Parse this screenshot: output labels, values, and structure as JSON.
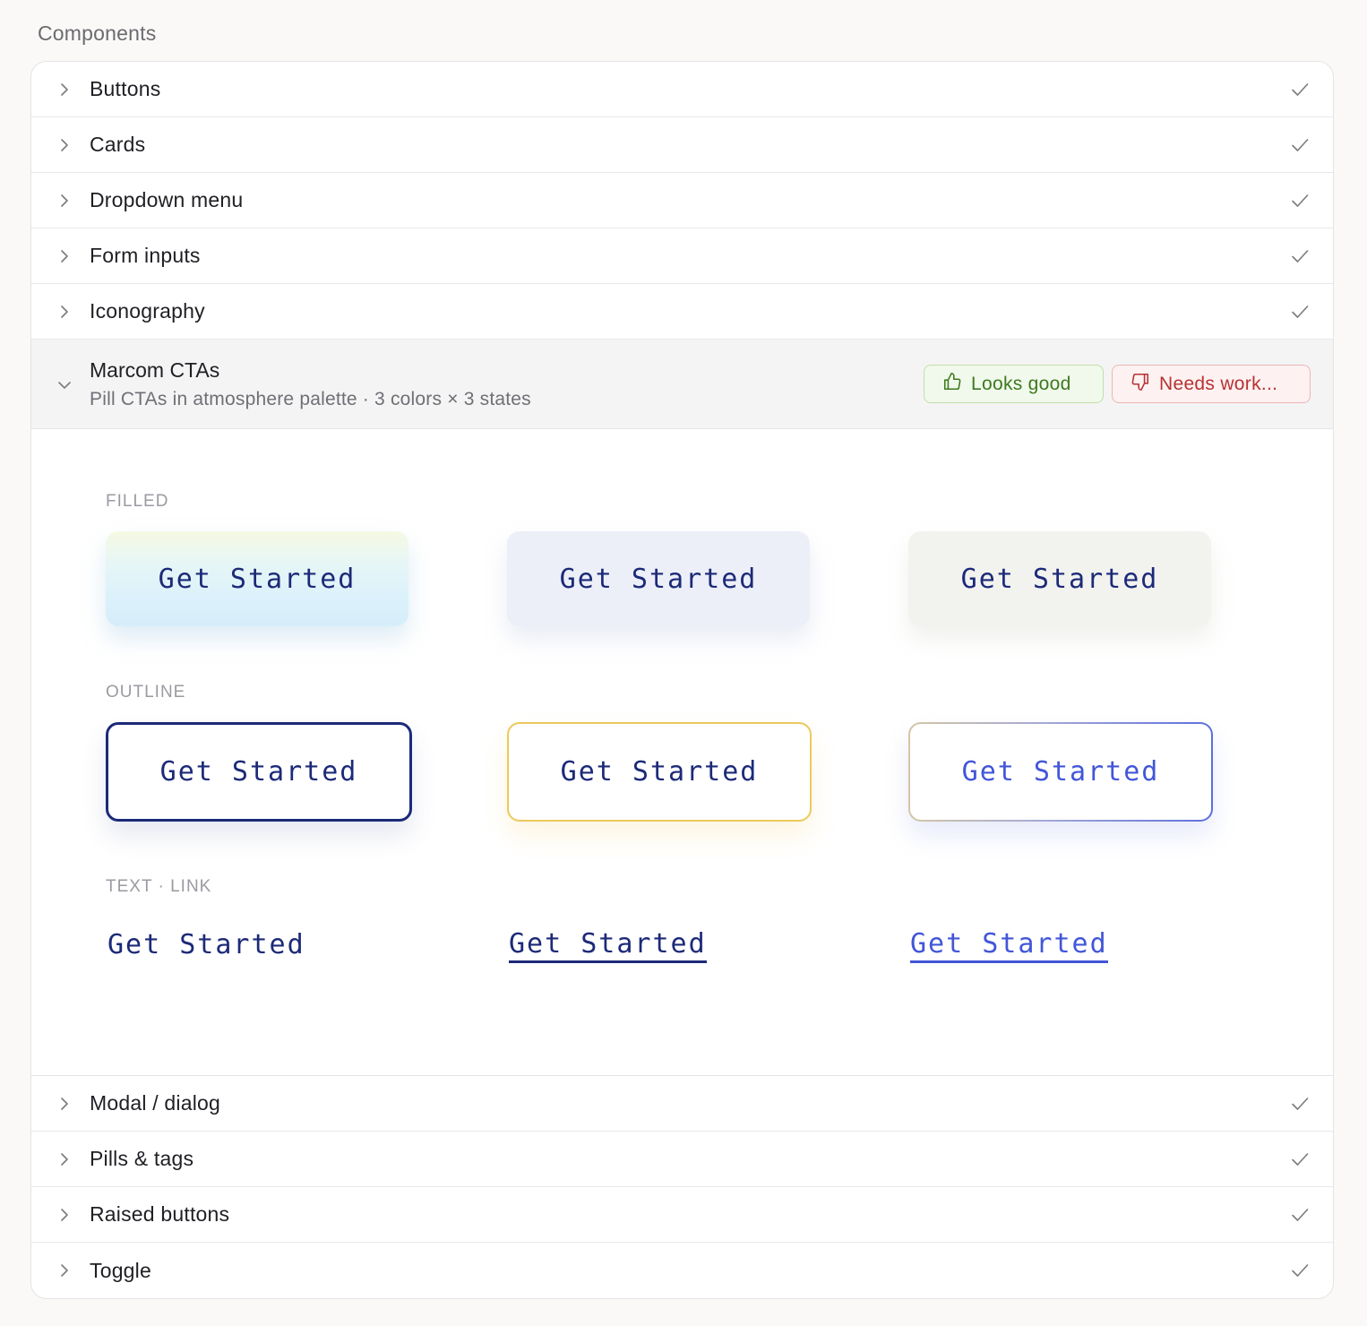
{
  "section": {
    "title": "Components"
  },
  "accordion": {
    "items_top": [
      {
        "label": "Buttons",
        "status_icon": "check-icon"
      },
      {
        "label": "Cards",
        "status_icon": "check-icon"
      },
      {
        "label": "Dropdown menu",
        "status_icon": "check-icon"
      },
      {
        "label": "Form inputs",
        "status_icon": "check-icon"
      },
      {
        "label": "Iconography",
        "status_icon": "check-icon"
      }
    ],
    "expanded": {
      "title": "Marcom CTAs",
      "subtitle": "Pill CTAs in atmosphere palette · 3 colors × 3 states",
      "approve_label": "Looks good",
      "reject_label": "Needs work...",
      "approve_icon": "thumbs-up-icon",
      "reject_icon": "thumbs-down-icon",
      "colors": {
        "approve": "#3d7a1e",
        "reject": "#b83232",
        "navy": "#1c2a78",
        "blue": "#4256d8",
        "gold": "#ecc95c"
      },
      "groups": {
        "filled": {
          "label": "FILLED",
          "buttons": [
            "Get Started",
            "Get Started",
            "Get Started"
          ]
        },
        "outline": {
          "label": "OUTLINE",
          "buttons": [
            "Get Started",
            "Get Started",
            "Get Started"
          ]
        },
        "text_link": {
          "label": "TEXT · LINK",
          "buttons": [
            "Get Started",
            "Get Started",
            "Get Started"
          ]
        }
      }
    },
    "items_bottom": [
      {
        "label": "Modal / dialog",
        "status_icon": "check-icon"
      },
      {
        "label": "Pills & tags",
        "status_icon": "check-icon"
      },
      {
        "label": "Raised buttons",
        "status_icon": "check-icon"
      },
      {
        "label": "Toggle",
        "status_icon": "check-icon"
      }
    ]
  }
}
